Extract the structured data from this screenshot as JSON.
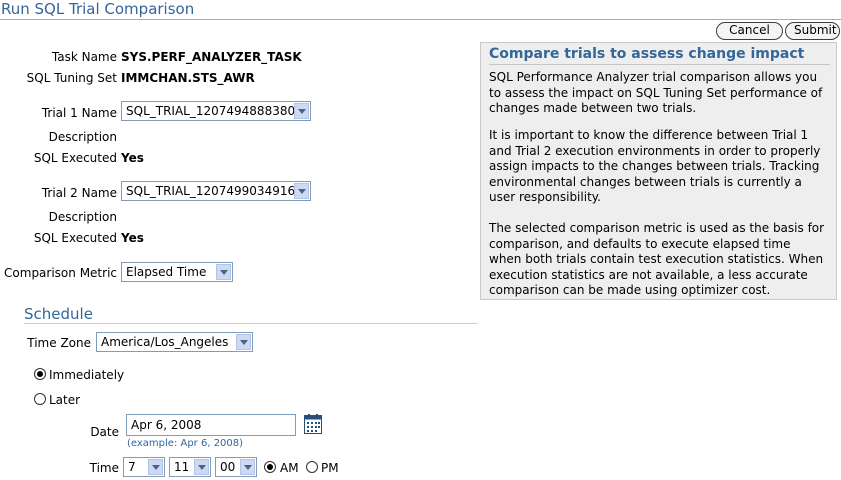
{
  "page": {
    "title": "Run SQL Trial Comparison"
  },
  "buttons": {
    "cancel": "Cancel",
    "submit": "Submit"
  },
  "form": {
    "task_name_label": "Task Name",
    "task_name_value": "SYS.PERF_ANALYZER_TASK",
    "sts_label": "SQL Tuning Set",
    "sts_value": "IMMCHAN.STS_AWR",
    "trial1_label": "Trial 1 Name",
    "trial1_value": "SQL_TRIAL_1207494888380",
    "desc1_label": "Description",
    "exec1_label": "SQL Executed",
    "exec1_value": "Yes",
    "trial2_label": "Trial 2 Name",
    "trial2_value": "SQL_TRIAL_1207499034916",
    "desc2_label": "Description",
    "exec2_label": "SQL Executed",
    "exec2_value": "Yes",
    "metric_label": "Comparison Metric",
    "metric_value": "Elapsed Time"
  },
  "schedule": {
    "title": "Schedule",
    "tz_label": "Time Zone",
    "tz_value": "America/Los_Angeles",
    "immediately": "Immediately",
    "later": "Later",
    "selected": "immediately",
    "date_label": "Date",
    "date_value": "Apr 6, 2008",
    "date_hint": "(example: Apr 6, 2008)",
    "time_label": "Time",
    "hour": "7",
    "minute": "11",
    "second": "00",
    "am": "AM",
    "pm": "PM",
    "ampm_selected": "AM"
  },
  "help": {
    "title": "Compare trials to assess change impact",
    "p1": "SQL Performance Analyzer trial comparison allows you to assess the impact on SQL Tuning Set performance of changes made between two trials.",
    "p2": "It is important to know the difference between Trial 1 and Trial 2 execution environments in order to properly assign impacts to the changes between trials. Tracking environmental changes between trials is currently a user responsibility.",
    "p3": "The selected comparison metric is used as the basis for comparison, and defaults to execute elapsed time when both trials contain test execution statistics. When execution statistics are not available, a less accurate comparison can be made using optimizer cost."
  }
}
